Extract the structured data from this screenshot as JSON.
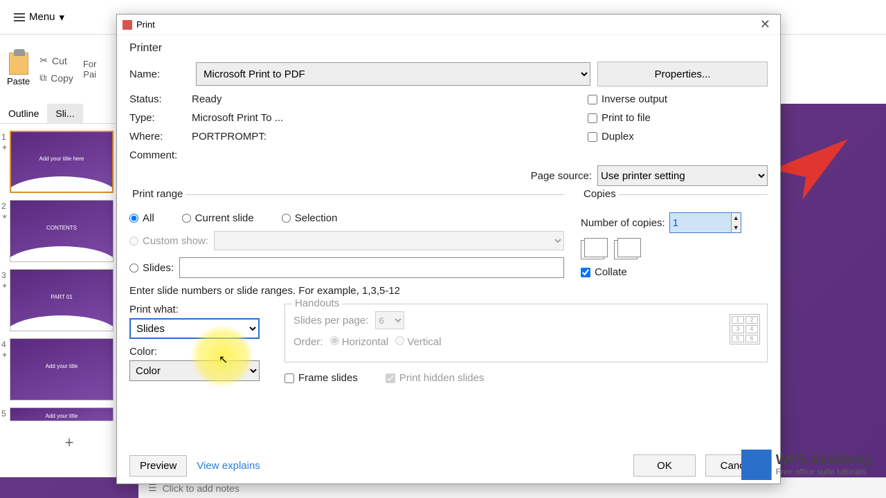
{
  "toolbar": {
    "menu": "Menu",
    "paste": "Paste",
    "cut": "Cut",
    "copy": "Copy",
    "format_painter_l1": "For",
    "format_painter_l2": "Pai"
  },
  "panel": {
    "outline": "Outline",
    "slides": "Sli..."
  },
  "thumbs": [
    {
      "num": "1",
      "title": "Add your title here"
    },
    {
      "num": "2",
      "title": "CONTENTS"
    },
    {
      "num": "3",
      "title": "PART 01"
    },
    {
      "num": "4",
      "title": "Add your title"
    },
    {
      "num": "5",
      "title": "Add your title"
    }
  ],
  "notes": "Click to add notes",
  "dialog": {
    "title": "Print",
    "printer_section": "Printer",
    "name_label": "Name:",
    "name_value": "Microsoft Print to PDF",
    "properties": "Properties...",
    "status_label": "Status:",
    "status_value": "Ready",
    "type_label": "Type:",
    "type_value": "Microsoft Print To ...",
    "where_label": "Where:",
    "where_value": "PORTPROMPT:",
    "comment_label": "Comment:",
    "inverse": "Inverse output",
    "print_to_file": "Print to file",
    "duplex": "Duplex",
    "page_source_label": "Page source:",
    "page_source_value": "Use printer setting",
    "range_title": "Print range",
    "all": "All",
    "current_slide": "Current slide",
    "selection": "Selection",
    "custom_show": "Custom show:",
    "slides": "Slides:",
    "range_hint": "Enter slide numbers or slide ranges. For example, 1,3,5-12",
    "copies_title": "Copies",
    "num_copies_label": "Number of copies:",
    "num_copies_value": "1",
    "collate": "Collate",
    "print_what_label": "Print what:",
    "print_what_value": "Slides",
    "color_label": "Color:",
    "color_value": "Color",
    "handouts_title": "Handouts",
    "spp_label": "Slides per page:",
    "spp_value": "6",
    "order_label": "Order:",
    "horizontal": "Horizontal",
    "vertical": "Vertical",
    "frame_slides": "Frame slides",
    "print_hidden": "Print hidden slides",
    "preview": "Preview",
    "view_explains": "View explains",
    "ok": "OK",
    "cancel": "Cancel"
  },
  "branding": {
    "name": "WPS Academy",
    "tagline": "Free office suite tutorials"
  }
}
